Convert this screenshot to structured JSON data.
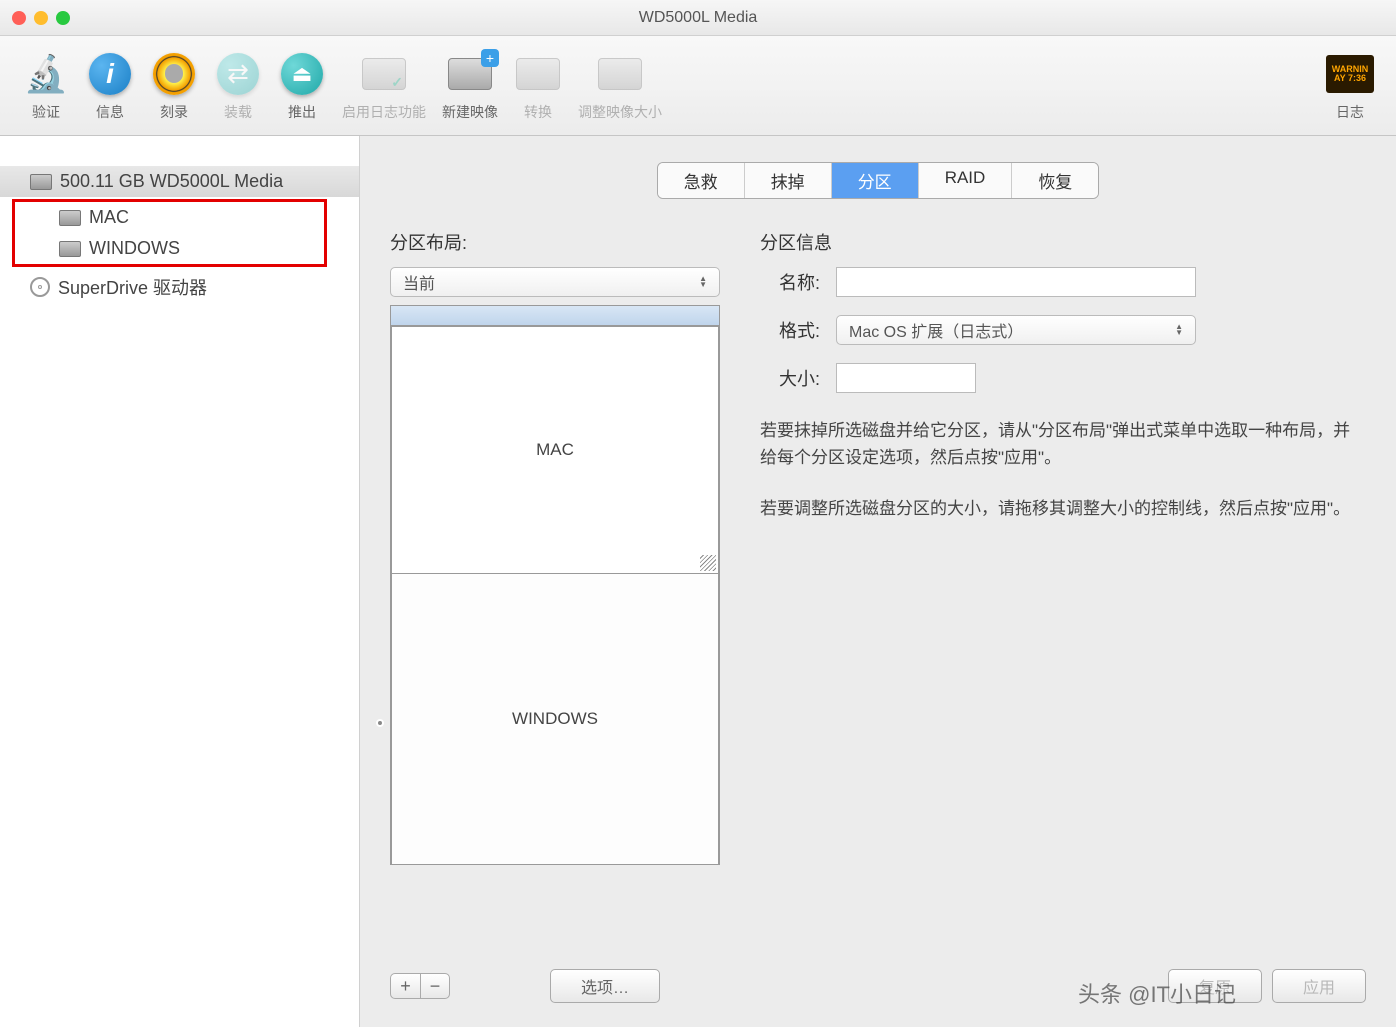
{
  "window": {
    "title": "WD5000L Media"
  },
  "toolbar": {
    "verify": "验证",
    "info": "信息",
    "burn": "刻录",
    "mount": "装载",
    "eject": "推出",
    "enable_log": "启用日志功能",
    "new_image": "新建映像",
    "convert": "转换",
    "resize_image": "调整映像大小",
    "log": "日志",
    "warn1": "WARNIN",
    "warn2": "AY 7:36"
  },
  "sidebar": {
    "disk": "500.11 GB WD5000L Media",
    "vol1": "MAC",
    "vol2": "WINDOWS",
    "drive": "SuperDrive 驱动器"
  },
  "tabs": {
    "first_aid": "急救",
    "erase": "抹掉",
    "partition": "分区",
    "raid": "RAID",
    "restore": "恢复"
  },
  "layout": {
    "label": "分区布局:",
    "dropdown": "当前",
    "part1": "MAC",
    "part2": "WINDOWS"
  },
  "info": {
    "label": "分区信息",
    "name_label": "名称:",
    "format_label": "格式:",
    "format_value": "Mac OS 扩展（日志式）",
    "size_label": "大小:",
    "help1": "若要抹掉所选磁盘并给它分区，请从\"分区布局\"弹出式菜单中选取一种布局，并给每个分区设定选项，然后点按\"应用\"。",
    "help2": "若要调整所选磁盘分区的大小，请拖移其调整大小的控制线，然后点按\"应用\"。"
  },
  "buttons": {
    "add": "+",
    "remove": "−",
    "options": "选项…",
    "revert": "复原",
    "apply": "应用"
  },
  "watermark": "头条 @IT小日记"
}
